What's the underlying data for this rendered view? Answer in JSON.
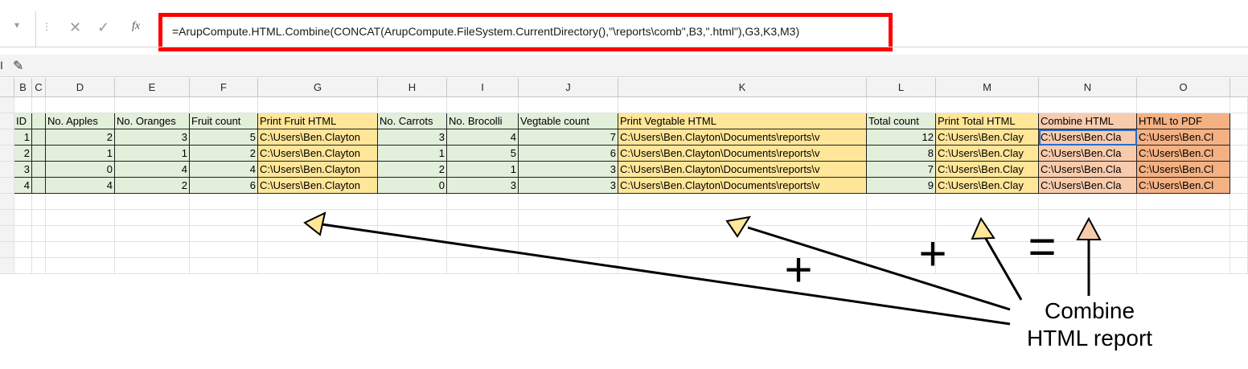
{
  "formula_bar": {
    "cancel_icon": "✕",
    "enter_icon": "✓",
    "fx_icon": "fx",
    "formula": "=ArupCompute.HTML.Combine(CONCAT(ArupCompute.FileSystem.CurrentDirectory(),\"\\reports\\comb\",B3,\".html\"),G3,K3,M3)"
  },
  "toolbar": {
    "pen_icon": "✎"
  },
  "columns": [
    "B",
    "C",
    "D",
    "E",
    "F",
    "G",
    "H",
    "I",
    "J",
    "K",
    "L",
    "M",
    "N",
    "O"
  ],
  "headers": [
    "ID",
    "No. Apples",
    "No. Oranges",
    "Fruit count",
    "Print Fruit HTML",
    "No. Carrots",
    "No. Brocolli",
    "Vegtable count",
    "Print Vegtable HTML",
    "Total count",
    "Print Total HTML",
    "Combine HTML",
    "HTML to PDF"
  ],
  "rows": [
    [
      "1",
      "2",
      "3",
      "5",
      "C:\\Users\\Ben.Clayton",
      "3",
      "4",
      "7",
      "C:\\Users\\Ben.Clayton\\Documents\\reports\\v",
      "12",
      "C:\\Users\\Ben.Clay",
      "C:\\Users\\Ben.Cla",
      "C:\\Users\\Ben.Cl"
    ],
    [
      "2",
      "1",
      "1",
      "2",
      "C:\\Users\\Ben.Clayton",
      "1",
      "5",
      "6",
      "C:\\Users\\Ben.Clayton\\Documents\\reports\\v",
      "8",
      "C:\\Users\\Ben.Clay",
      "C:\\Users\\Ben.Cla",
      "C:\\Users\\Ben.Cl"
    ],
    [
      "3",
      "0",
      "4",
      "4",
      "C:\\Users\\Ben.Clayton",
      "2",
      "1",
      "3",
      "C:\\Users\\Ben.Clayton\\Documents\\reports\\v",
      "7",
      "C:\\Users\\Ben.Clay",
      "C:\\Users\\Ben.Cla",
      "C:\\Users\\Ben.Cl"
    ],
    [
      "4",
      "4",
      "2",
      "6",
      "C:\\Users\\Ben.Clayton",
      "0",
      "3",
      "3",
      "C:\\Users\\Ben.Clayton\\Documents\\reports\\v",
      "9",
      "C:\\Users\\Ben.Clay",
      "C:\\Users\\Ben.Cla",
      "C:\\Users\\Ben.Cl"
    ]
  ],
  "colors": {
    "green": "#e2efda",
    "yellow": "#ffe699",
    "peach": "#f8cbad",
    "orange": "#f4b183",
    "highlight_red": "#ff0000",
    "selection_blue": "#1f6fd1"
  },
  "annotation": {
    "plus1": "+",
    "plus2": "+",
    "equals": "=",
    "label": "Combine\nHTML report"
  }
}
